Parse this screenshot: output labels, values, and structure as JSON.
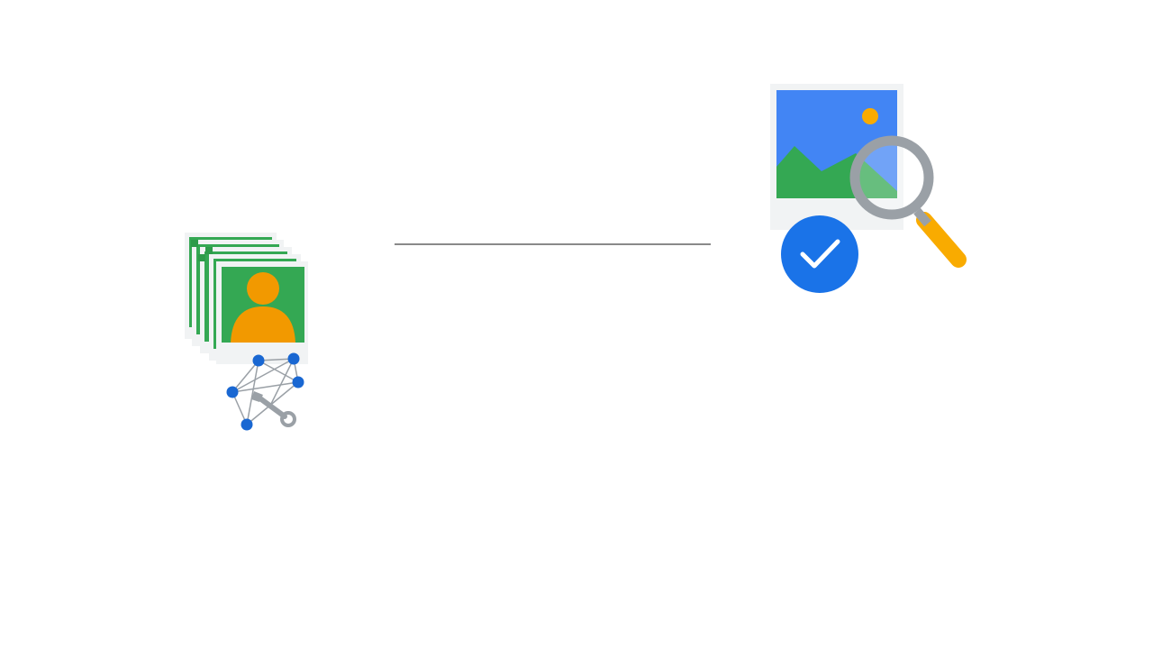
{
  "diagram": {
    "left_node": {
      "icon": "image-dataset-training-icon",
      "colors": {
        "photo_bg": "#34a853",
        "person": "#f29900",
        "frame": "#f1f3f4",
        "node": "#1967d2",
        "edge": "#9aa0a6",
        "wrench": "#9aa0a6"
      }
    },
    "connector": {
      "icon": "connector-line",
      "color": "#8a8a8a"
    },
    "right_node": {
      "icon": "image-inspection-verified-icon",
      "colors": {
        "sky": "#4285f4",
        "mountains": "#34a853",
        "sun": "#f9ab00",
        "frame": "#f1f3f4",
        "magnifier_ring": "#9aa0a6",
        "magnifier_handle": "#f9ab00",
        "check_badge": "#1a73e8"
      }
    }
  }
}
